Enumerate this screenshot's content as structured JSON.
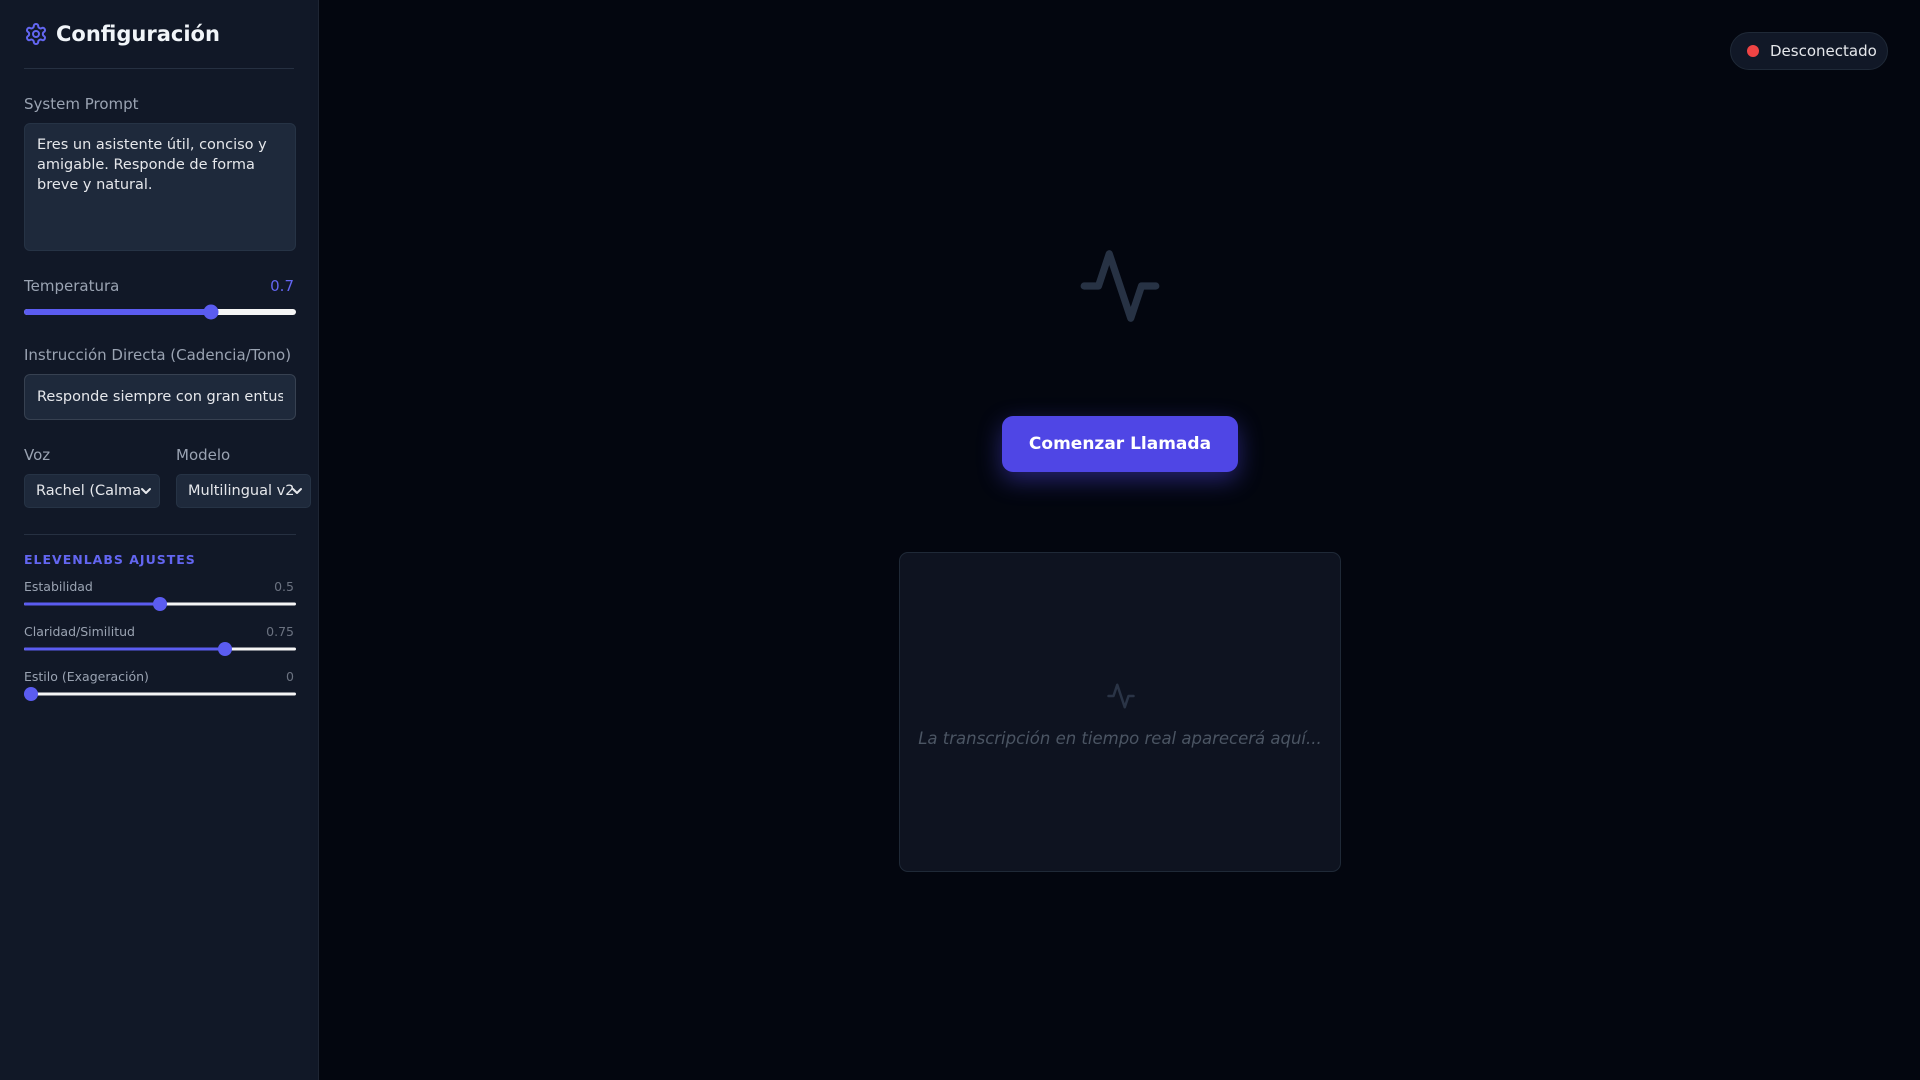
{
  "sidebar": {
    "title": "Configuración",
    "system_prompt": {
      "label": "System Prompt",
      "value": "Eres un asistente útil, conciso y amigable. Responde de forma breve y natural."
    },
    "temperature": {
      "label": "Temperatura",
      "value": "0.7",
      "fraction": 0.7
    },
    "instruction": {
      "label": "Instrucción Directa (Cadencia/Tono)",
      "value": "Responde siempre con gran entusiasmo"
    },
    "voice": {
      "label": "Voz",
      "selected": "Rachel (Calma"
    },
    "model": {
      "label": "Modelo",
      "selected": "Multilingual v2"
    },
    "elevenlabs": {
      "title": "ELEVENLABS AJUSTES",
      "stability": {
        "label": "Estabilidad",
        "value": "0.5",
        "fraction": 0.5
      },
      "clarity": {
        "label": "Claridad/Similitud",
        "value": "0.75",
        "fraction": 0.75
      },
      "style": {
        "label": "Estilo (Exageración)",
        "value": "0",
        "fraction": 0.0
      }
    }
  },
  "status": {
    "label": "Desconectado",
    "color": "#ef4444"
  },
  "main": {
    "start_button": "Comenzar Llamada",
    "transcript_placeholder": "La transcripción en tiempo real aparecerá aquí..."
  },
  "colors": {
    "accent": "#4f46e5",
    "background": "#03060f",
    "sidebar": "#111827"
  },
  "icons": {
    "header": "gear-icon",
    "hero": "activity-pulse-icon",
    "transcript": "activity-pulse-icon"
  }
}
